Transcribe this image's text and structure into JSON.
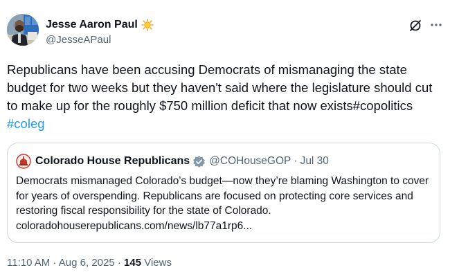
{
  "author": {
    "display_name": "Jesse Aaron Paul",
    "handle": "@JesseAPaul",
    "badge_icon": "sun-emoji-icon"
  },
  "actions": {
    "grok_icon": "grok-icon",
    "more_icon": "more-icon"
  },
  "tweet": {
    "text": "Republicans have been accusing Democrats of mismanaging the state budget for two weeks but they haven't said where the legislature should cut to make up for the roughly $750 million deficit that now exists#copolitics ",
    "hashtag": "#coleg"
  },
  "quoted": {
    "display_name": "Colorado House Republicans",
    "handle": "@COHouseGOP",
    "separator": "·",
    "date": "Jul 30",
    "text": "Democrats mismanaged Colorado’s budget—now they’re blaming Washington to cover for years of overspending. Republicans are focused on protecting core services and restoring fiscal responsibility for the state of Colorado.",
    "link": "coloradohouserepublicans.com/news/lb77a1rp6..."
  },
  "meta": {
    "time": "11:10 AM",
    "separator": "·",
    "date": "Aug 6, 2025",
    "views_count": "145",
    "views_label": "Views"
  },
  "colors": {
    "link_blue": "#1d9bf0",
    "secondary_text": "#536471",
    "primary_text": "#0f1419",
    "border": "#cfd9de",
    "verified_grey": "#829aab"
  }
}
